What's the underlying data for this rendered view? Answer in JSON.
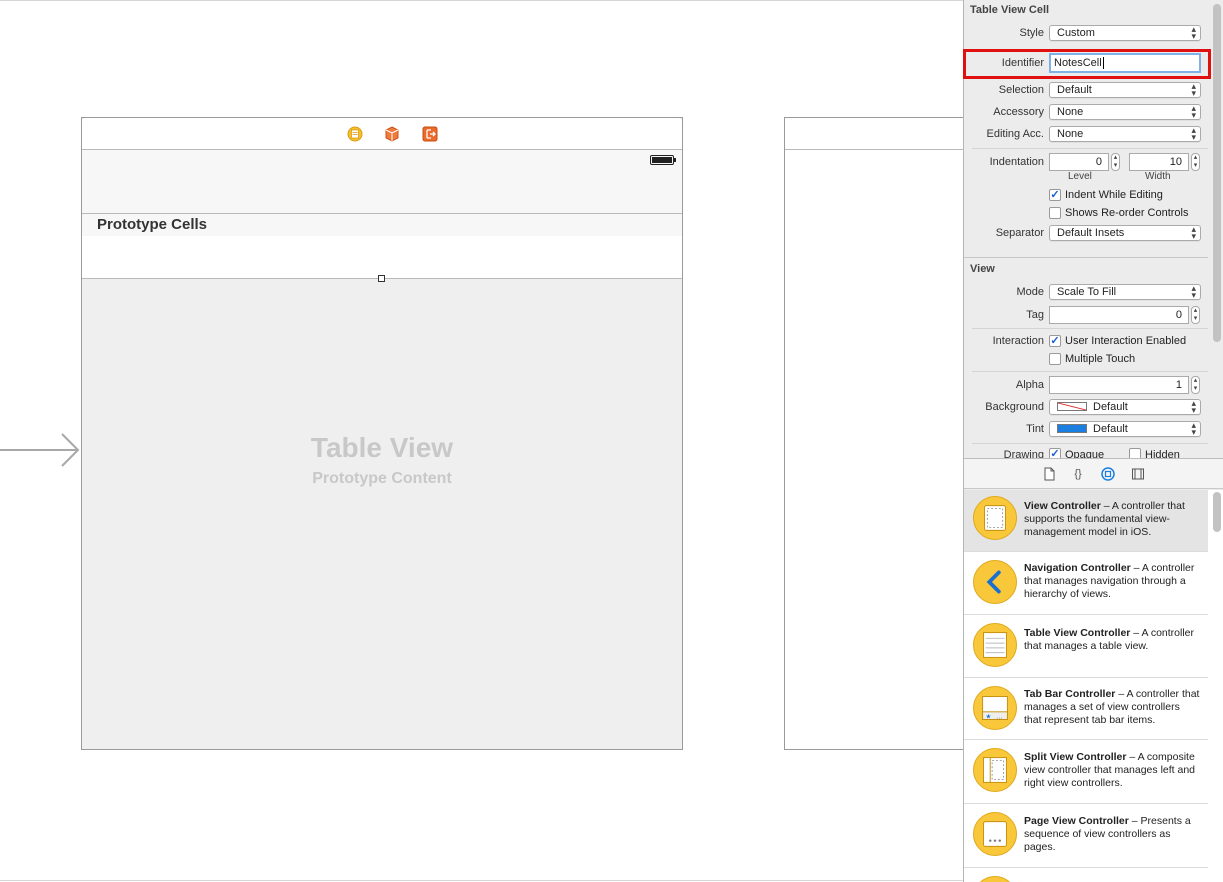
{
  "canvas": {
    "scene_title": "Table View",
    "scene_subtitle": "Prototype Content",
    "prototype_header": "Prototype Cells",
    "dock_icons": [
      "view-controller-icon",
      "first-responder-icon",
      "exit-icon"
    ]
  },
  "inspector": {
    "cell_section_title": "Table View Cell",
    "style_label": "Style",
    "style_value": "Custom",
    "identifier_label": "Identifier",
    "identifier_value": "NotesCell",
    "selection_label": "Selection",
    "selection_value": "Default",
    "accessory_label": "Accessory",
    "accessory_value": "None",
    "editing_acc_label": "Editing Acc.",
    "editing_acc_value": "None",
    "indentation_label": "Indentation",
    "level_value": "0",
    "width_value": "10",
    "level_label": "Level",
    "width_label": "Width",
    "indent_while_editing": "Indent While Editing",
    "shows_reorder": "Shows Re-order Controls",
    "separator_label": "Separator",
    "separator_value": "Default Insets",
    "view_section_title": "View",
    "mode_label": "Mode",
    "mode_value": "Scale To Fill",
    "tag_label": "Tag",
    "tag_value": "0",
    "interaction_label": "Interaction",
    "user_interaction": "User Interaction Enabled",
    "multiple_touch": "Multiple Touch",
    "alpha_label": "Alpha",
    "alpha_value": "1",
    "background_label": "Background",
    "background_value": "Default",
    "tint_label": "Tint",
    "tint_value": "Default",
    "tint_color": "#1a7fe0",
    "drawing_label": "Drawing",
    "opaque_label": "Opaque",
    "hidden_label": "Hidden"
  },
  "library": {
    "tab_icons": [
      "file-template-icon",
      "code-snippet-icon",
      "object-library-icon",
      "media-library-icon"
    ],
    "items": [
      {
        "name": "View Controller",
        "desc": " – A controller that supports the fundamental view-management model in iOS."
      },
      {
        "name": "Navigation Controller",
        "desc": " – A controller that manages navigation through a hierarchy of views."
      },
      {
        "name": "Table View Controller",
        "desc": " – A controller that manages a table view."
      },
      {
        "name": "Tab Bar Controller",
        "desc": " – A controller that manages a set of view controllers that represent tab bar items."
      },
      {
        "name": "Split View Controller",
        "desc": " – A composite view controller that manages left and right view controllers."
      },
      {
        "name": "Page View Controller",
        "desc": " – Presents a sequence of view controllers as pages."
      }
    ]
  }
}
